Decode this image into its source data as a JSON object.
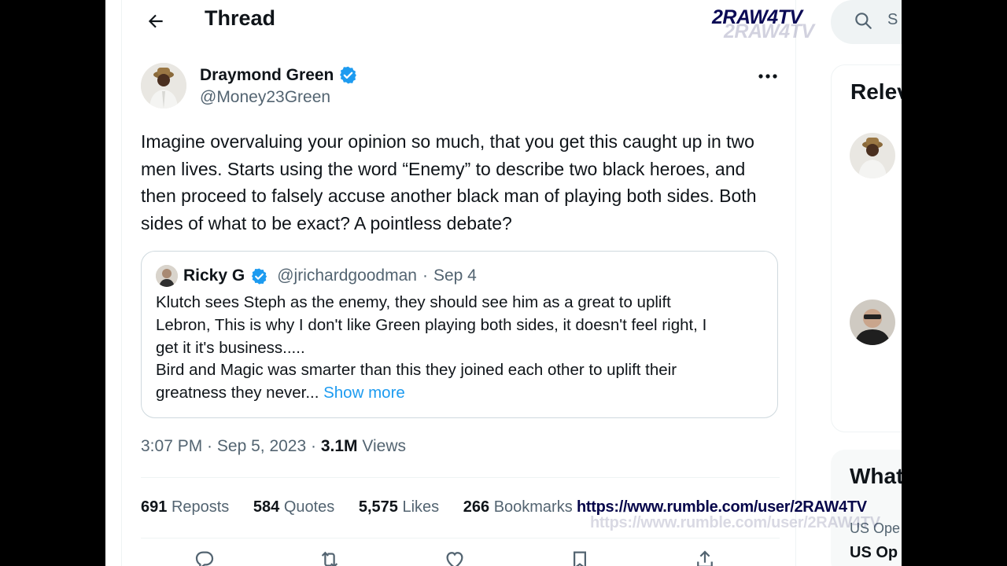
{
  "header": {
    "title": "Thread"
  },
  "tweet": {
    "author_name": "Draymond Green",
    "author_handle": "@Money23Green",
    "text": "Imagine overvaluing your opinion so much, that you get this caught up in two men lives. Starts using the word “Enemy” to describe two black heroes, and then proceed to falsely accuse another black man of playing both sides. Both sides of what to be exact? A pointless debate?",
    "time": "3:07 PM",
    "date": "Sep 5, 2023",
    "views_count": "3.1M",
    "views_label": "Views"
  },
  "quote": {
    "name": "Ricky G",
    "handle": "@jrichardgoodman",
    "date": "Sep 4",
    "lines": [
      "Klutch sees Steph as the enemy, they should see him as a great to uplift",
      "Lebron, This is why I don't like Green playing both sides, it doesn't feel right, I",
      "get it it's business.....",
      "Bird and Magic was smarter than this they joined each other to uplift their",
      "greatness they never..."
    ],
    "show_more": "Show more"
  },
  "stats": [
    {
      "count": "691",
      "label": "Reposts"
    },
    {
      "count": "584",
      "label": "Quotes"
    },
    {
      "count": "5,575",
      "label": "Likes"
    },
    {
      "count": "266",
      "label": "Bookmarks"
    }
  ],
  "sidebar": {
    "search_placeholder": "S",
    "relevant_title": "Relev",
    "whats_title": "What",
    "trend_1": "US Ope",
    "trend_2": "US Op"
  },
  "watermark": {
    "brand": "2RAW4TV",
    "url": "https://www.rumble.com/user/2RAW4TV"
  },
  "colors": {
    "accent": "#1d9bf0",
    "text": "#0f1419",
    "secondary": "#536471",
    "border": "#cfd9de",
    "verified": "#1d9bf0"
  }
}
